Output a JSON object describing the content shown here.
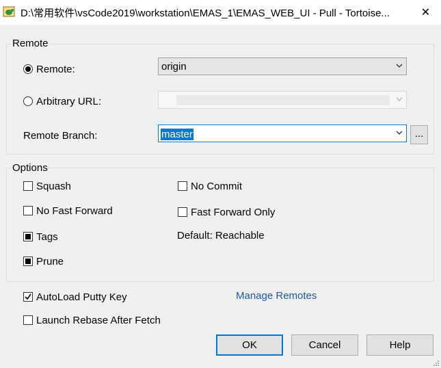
{
  "window": {
    "title": "D:\\常用软件\\vsCode2019\\workstation\\EMAS_1\\EMAS_WEB_UI - Pull - Tortoise...",
    "close_glyph": "✕"
  },
  "remote_group": {
    "label": "Remote",
    "remote_radio_label": "Remote:",
    "remote_value": "origin",
    "arbitrary_url_label": "Arbitrary URL:",
    "arbitrary_url_value": "",
    "remote_branch_label": "Remote Branch:",
    "remote_branch_value": "master",
    "browse_label": "..."
  },
  "options_group": {
    "label": "Options",
    "squash": "Squash",
    "no_fast_forward": "No Fast Forward",
    "tags": "Tags",
    "prune": "Prune",
    "no_commit": "No Commit",
    "fast_forward_only": "Fast Forward Only",
    "default_reachable": "Default: Reachable"
  },
  "bottom": {
    "autoload_putty_key": "AutoLoad Putty Key",
    "launch_rebase": "Launch Rebase After Fetch",
    "manage_remotes": "Manage Remotes",
    "ok": "OK",
    "cancel": "Cancel",
    "help": "Help"
  },
  "state": {
    "selected_source": "remote",
    "squash": false,
    "no_fast_forward": false,
    "tags": "indeterminate",
    "prune": "indeterminate",
    "no_commit": false,
    "fast_forward_only": false,
    "autoload_putty_key": true,
    "launch_rebase": false
  }
}
